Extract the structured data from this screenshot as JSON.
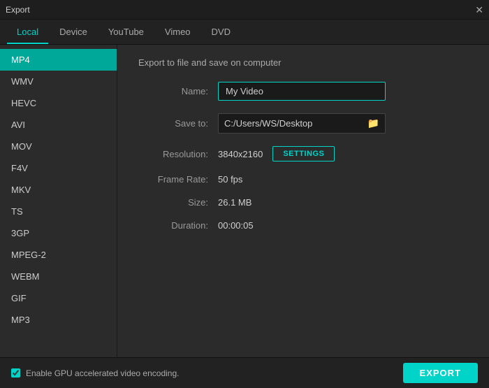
{
  "titleBar": {
    "title": "Export",
    "closeLabel": "✕"
  },
  "tabs": [
    {
      "id": "local",
      "label": "Local",
      "active": true
    },
    {
      "id": "device",
      "label": "Device",
      "active": false
    },
    {
      "id": "youtube",
      "label": "YouTube",
      "active": false
    },
    {
      "id": "vimeo",
      "label": "Vimeo",
      "active": false
    },
    {
      "id": "dvd",
      "label": "DVD",
      "active": false
    }
  ],
  "sidebar": {
    "items": [
      {
        "id": "mp4",
        "label": "MP4",
        "active": true
      },
      {
        "id": "wmv",
        "label": "WMV",
        "active": false
      },
      {
        "id": "hevc",
        "label": "HEVC",
        "active": false
      },
      {
        "id": "avi",
        "label": "AVI",
        "active": false
      },
      {
        "id": "mov",
        "label": "MOV",
        "active": false
      },
      {
        "id": "f4v",
        "label": "F4V",
        "active": false
      },
      {
        "id": "mkv",
        "label": "MKV",
        "active": false
      },
      {
        "id": "ts",
        "label": "TS",
        "active": false
      },
      {
        "id": "3gp",
        "label": "3GP",
        "active": false
      },
      {
        "id": "mpeg2",
        "label": "MPEG-2",
        "active": false
      },
      {
        "id": "webm",
        "label": "WEBM",
        "active": false
      },
      {
        "id": "gif",
        "label": "GIF",
        "active": false
      },
      {
        "id": "mp3",
        "label": "MP3",
        "active": false
      }
    ]
  },
  "content": {
    "exportTitle": "Export to file and save on computer",
    "nameLabel": "Name:",
    "nameValue": "My Video",
    "saveToLabel": "Save to:",
    "saveToPath": "C:/Users/WS/Desktop",
    "resolutionLabel": "Resolution:",
    "resolutionValue": "3840x2160",
    "settingsLabel": "SETTINGS",
    "frameRateLabel": "Frame Rate:",
    "frameRateValue": "50 fps",
    "sizeLabel": "Size:",
    "sizeValue": "26.1 MB",
    "durationLabel": "Duration:",
    "durationValue": "00:00:05"
  },
  "footer": {
    "gpuLabel": "Enable GPU accelerated video encoding.",
    "exportLabel": "EXPORT"
  },
  "icons": {
    "close": "✕",
    "folder": "🗁"
  }
}
